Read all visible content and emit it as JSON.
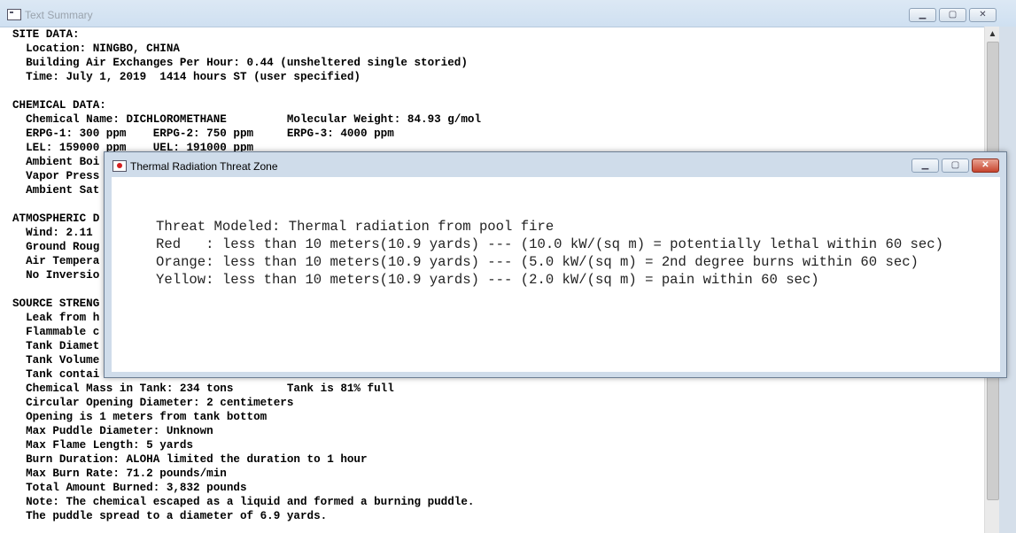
{
  "main_window": {
    "title": "Text Summary",
    "lines": [
      "SITE DATA:",
      "  Location: NINGBO, CHINA",
      "  Building Air Exchanges Per Hour: 0.44 (unsheltered single storied)",
      "  Time: July 1, 2019  1414 hours ST (user specified)",
      "",
      "CHEMICAL DATA:",
      "  Chemical Name: DICHLOROMETHANE         Molecular Weight: 84.93 g/mol",
      "  ERPG-1: 300 ppm    ERPG-2: 750 ppm     ERPG-3: 4000 ppm",
      "  LEL: 159000 ppm    UEL: 191000 ppm",
      "  Ambient Boi",
      "  Vapor Press",
      "  Ambient Sat",
      "",
      "ATMOSPHERIC D",
      "  Wind: 2.11",
      "  Ground Roug",
      "  Air Tempera",
      "  No Inversio",
      "",
      "SOURCE STRENG",
      "  Leak from h",
      "  Flammable c",
      "  Tank Diamet",
      "  Tank Volume",
      "  Tank contai",
      "  Chemical Mass in Tank: 234 tons        Tank is 81% full",
      "  Circular Opening Diameter: 2 centimeters",
      "  Opening is 1 meters from tank bottom",
      "  Max Puddle Diameter: Unknown",
      "  Max Flame Length: 5 yards",
      "  Burn Duration: ALOHA limited the duration to 1 hour",
      "  Max Burn Rate: 71.2 pounds/min",
      "  Total Amount Burned: 3,832 pounds",
      "  Note: The chemical escaped as a liquid and formed a burning puddle.",
      "  The puddle spread to a diameter of 6.9 yards."
    ]
  },
  "dialog": {
    "title": "Thermal Radiation Threat Zone",
    "lines": [
      "Threat Modeled: Thermal radiation from pool fire",
      "Red   : less than 10 meters(10.9 yards) --- (10.0 kW/(sq m) = potentially lethal within 60 sec)",
      "Orange: less than 10 meters(10.9 yards) --- (5.0 kW/(sq m) = 2nd degree burns within 60 sec)",
      "Yellow: less than 10 meters(10.9 yards) --- (2.0 kW/(sq m) = pain within 60 sec)"
    ]
  },
  "icons": {
    "app": "app-icon",
    "dialog": "threat-zone-icon",
    "minimize": "minimize-icon",
    "maximize": "maximize-icon",
    "close": "close-icon",
    "scroll_up": "scroll-up-arrow-icon"
  },
  "colors": {
    "titlebar": "#cfe0f1",
    "close_button": "#c7452e"
  }
}
